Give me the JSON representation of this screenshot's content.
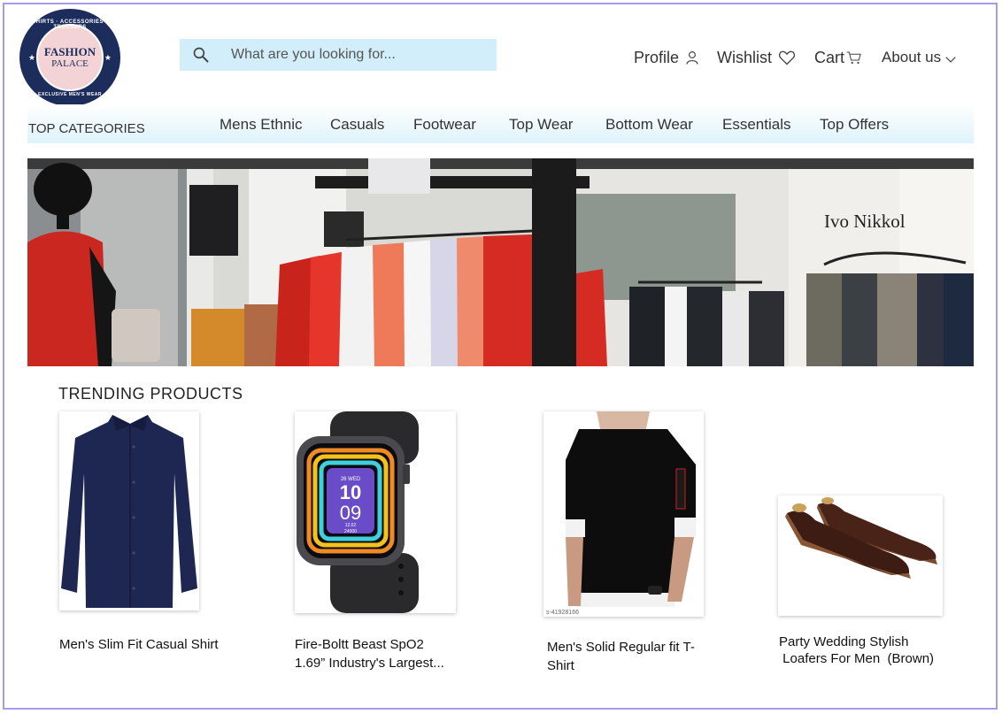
{
  "brand": {
    "name": "FASHION",
    "sub": "PALACE",
    "tagline_top": "SHIRTS · ACCESSORIES · TROUSERS",
    "tagline_bottom": "EXCLUSIVE MEN'S WEAR"
  },
  "search": {
    "placeholder": "What are you looking for..."
  },
  "header_nav": {
    "profile": "Profile",
    "wishlist": "Wishlist",
    "cart": "Cart",
    "about": "About us"
  },
  "categories": {
    "title": "TOP CATEGORIES",
    "items": [
      "Mens Ethnic",
      "Casuals",
      "Footwear",
      "Top Wear",
      "Bottom Wear",
      "Essentials",
      "Top Offers"
    ]
  },
  "hero": {
    "store_sign": "Ivo Nikkol"
  },
  "trending": {
    "title": "TRENDING  PRODUCTS",
    "products": [
      {
        "name_line1": "Men's Slim Fit Casual Shirt",
        "name_line2": ""
      },
      {
        "name_line1": "Fire-Boltt Beast SpO2",
        "name_line2": "1.69” Industry's Largest..."
      },
      {
        "name_line1": "Men's Solid Regular fit T-",
        "name_line2": "Shirt"
      },
      {
        "name_line1": "Party Wedding Stylish",
        "name_line2": " Loafers For Men  (Brown)"
      }
    ],
    "watch_face": {
      "date": "26 WED",
      "hour": "10",
      "minute": "09",
      "stat1": "12.02",
      "stat2": "24000"
    },
    "tshirt_code": "s-41928166"
  },
  "colors": {
    "frame": "#a49cf0",
    "search_bg": "#d3eefb",
    "logo_navy": "#1c2d5c",
    "logo_pink": "#f3d3d6"
  }
}
